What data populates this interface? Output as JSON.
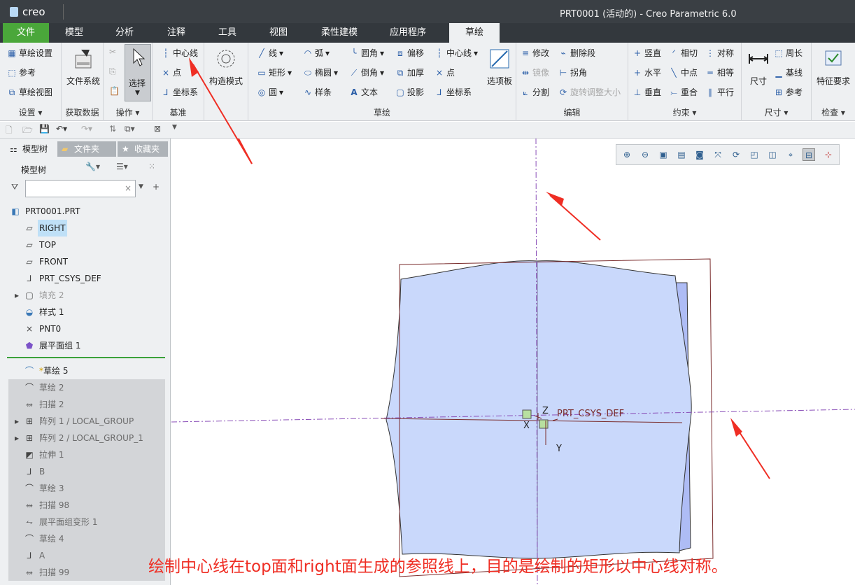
{
  "window": {
    "logo": "creo",
    "title": "PRT0001 (活动的) - Creo Parametric 6.0"
  },
  "tabs": [
    "文件",
    "模型",
    "分析",
    "注释",
    "工具",
    "视图",
    "柔性建模",
    "应用程序",
    "草绘"
  ],
  "ribbon": {
    "setup": {
      "items": [
        "草绘设置",
        "参考",
        "草绘视图"
      ],
      "label": "设置"
    },
    "get_data": {
      "file_system": "文件系统",
      "label": "获取数据"
    },
    "ops": {
      "select": "选择",
      "label": "操作"
    },
    "datum": {
      "items": [
        "中心线",
        "点",
        "坐标系"
      ],
      "label": "基准"
    },
    "construct": {
      "mode": "构造模式"
    },
    "sketch": {
      "col1": [
        "线",
        "矩形",
        "圆"
      ],
      "col2": [
        "弧",
        "椭圆",
        "样条"
      ],
      "col3": [
        "圆角",
        "倒角",
        "文本"
      ],
      "col4": [
        "偏移",
        "加厚",
        "投影"
      ],
      "col5": [
        "中心线",
        "点",
        "坐标系"
      ],
      "palette": "选项板",
      "label": "草绘"
    },
    "edit": {
      "col1": [
        "修改",
        "镜像",
        "分割"
      ],
      "col2": [
        "删除段",
        "拐角",
        "旋转调整大小"
      ],
      "label": "编辑"
    },
    "constrain": {
      "col1": [
        "竖直",
        "水平",
        "垂直"
      ],
      "col2": [
        "相切",
        "中点",
        "重合"
      ],
      "col3": [
        "对称",
        "相等",
        "平行"
      ],
      "label": "约束"
    },
    "dimension": {
      "dim": "尺寸",
      "items": [
        "周长",
        "基线",
        "参考"
      ],
      "label": "尺寸"
    },
    "inspect": {
      "feature_req": "特征要求",
      "label": "检查"
    }
  },
  "panel": {
    "tabs": [
      "模型树",
      "文件夹",
      "收藏夹"
    ],
    "tree_header": "模型树",
    "filter_value": "",
    "items": [
      {
        "label": "PRT0001.PRT"
      },
      {
        "label": "RIGHT"
      },
      {
        "label": "TOP"
      },
      {
        "label": "FRONT"
      },
      {
        "label": "PRT_CSYS_DEF"
      },
      {
        "label": "填充 2"
      },
      {
        "label": "样式 1"
      },
      {
        "label": "PNT0"
      },
      {
        "label": "展平面组 1"
      },
      {
        "label": "草绘 5"
      },
      {
        "label": "草绘 2"
      },
      {
        "label": "扫描 2"
      },
      {
        "label": "阵列 1 / LOCAL_GROUP"
      },
      {
        "label": "阵列 2 / LOCAL_GROUP_1"
      },
      {
        "label": "拉伸 1"
      },
      {
        "label": "B"
      },
      {
        "label": "草绘 3"
      },
      {
        "label": "扫描 98"
      },
      {
        "label": "展平面组变形 1"
      },
      {
        "label": "草绘 4"
      },
      {
        "label": "A"
      },
      {
        "label": "扫描 99"
      }
    ]
  },
  "canvas": {
    "csys_label": "PRT_CSYS_DEF",
    "axis_x": "X",
    "axis_y": "Y",
    "axis_z": "Z"
  },
  "annotation": "绘制中心线在top面和right面生成的参照线上，目的是绘制的矩形以中心线对称。",
  "colors": {
    "accent_green": "#4aa73a",
    "arrow_red": "#ef2e24",
    "part_fill": "#c9d8fb"
  }
}
